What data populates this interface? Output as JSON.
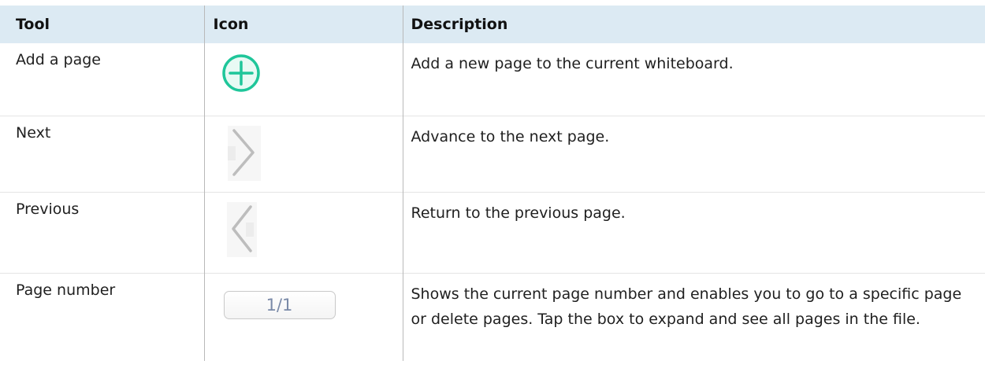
{
  "table": {
    "headers": [
      "Tool",
      "Icon",
      "Description"
    ],
    "rows": [
      {
        "tool": "Add a page",
        "icon": "plus-circle-icon",
        "description": "Add a new page to the current whiteboard."
      },
      {
        "tool": "Next",
        "icon": "chevron-right-icon",
        "description": "Advance to the next page."
      },
      {
        "tool": "Previous",
        "icon": "chevron-left-icon",
        "description": "Return to the previous page."
      },
      {
        "tool": "Page number",
        "icon": "page-number-box",
        "icon_text": "1/1",
        "description": "Shows the current page number and enables you to go to a specific page or delete pages. Tap the box to expand and see all pages in the file."
      }
    ]
  },
  "colors": {
    "header_bg": "#dceaf3",
    "plus_icon": "#1fc69a"
  }
}
